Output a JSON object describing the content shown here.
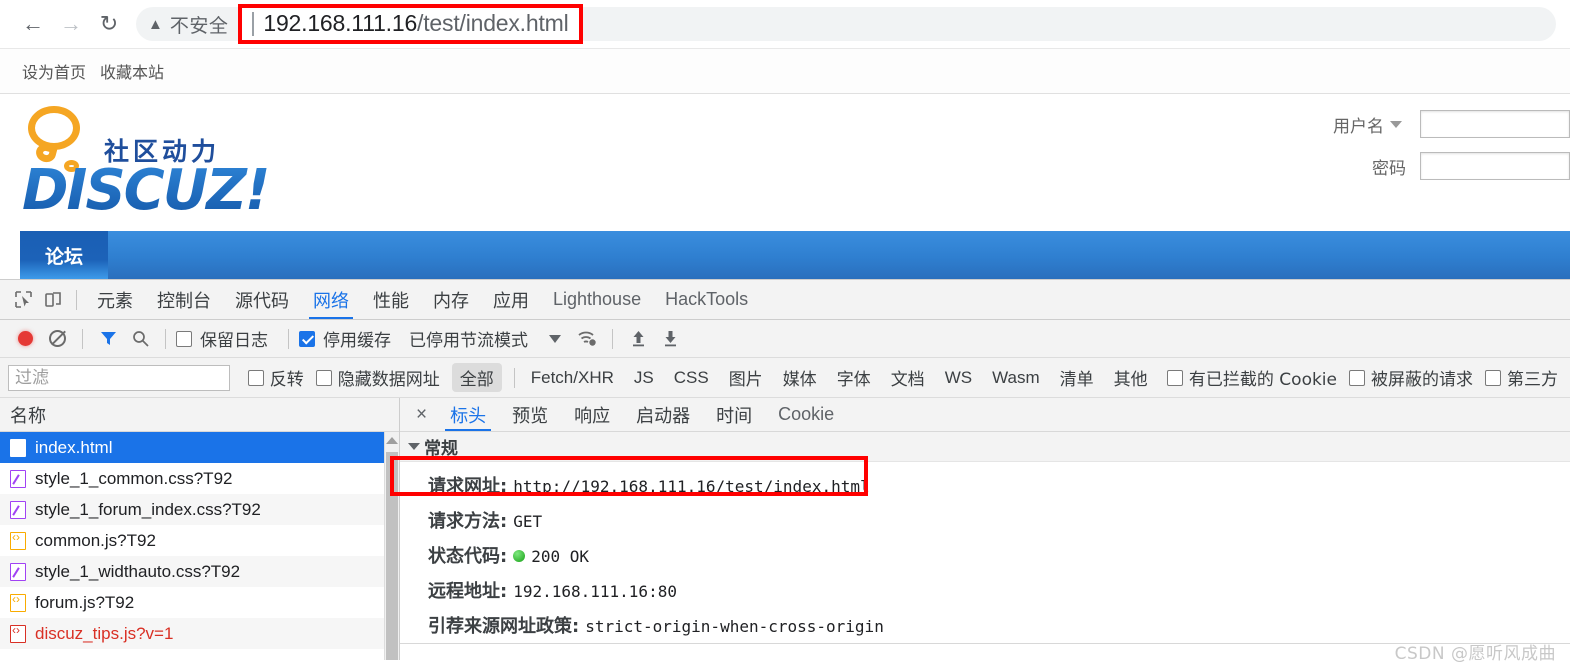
{
  "browser": {
    "back_icon": "arrow-left",
    "forward_icon": "arrow-right",
    "reload_icon": "reload",
    "security_label": "不安全",
    "url_host": "192.168.111.16",
    "url_path": "/test/index.html",
    "highlight_color": "#ff0000"
  },
  "page": {
    "quicknav": [
      "设为首页",
      "收藏本站"
    ],
    "logo": {
      "cn_tagline": "社区动力",
      "wordmark": "DISCUZ!"
    },
    "login": {
      "username_label": "用户名",
      "password_label": "密码",
      "username_value": "",
      "password_value": ""
    },
    "forum_nav": {
      "tab": "论坛"
    }
  },
  "devtools": {
    "tabs": [
      {
        "label": "元素",
        "active": false,
        "latin": false
      },
      {
        "label": "控制台",
        "active": false,
        "latin": false
      },
      {
        "label": "源代码",
        "active": false,
        "latin": false
      },
      {
        "label": "网络",
        "active": true,
        "latin": false
      },
      {
        "label": "性能",
        "active": false,
        "latin": false
      },
      {
        "label": "内存",
        "active": false,
        "latin": false
      },
      {
        "label": "应用",
        "active": false,
        "latin": false
      },
      {
        "label": "Lighthouse",
        "active": false,
        "latin": true
      },
      {
        "label": "HackTools",
        "active": false,
        "latin": true
      }
    ],
    "toolbar": {
      "record_icon": "record-dot",
      "clear_icon": "clear-circle",
      "filter_icon": "funnel-icon",
      "search_icon": "search-icon",
      "preserve_log_label": "保留日志",
      "preserve_log_checked": false,
      "disable_cache_label": "停用缓存",
      "disable_cache_checked": true,
      "throttle_label": "已停用节流模式",
      "wifi_icon": "wifi-gear-icon",
      "upload_icon": "upload-arrow",
      "download_icon": "download-arrow"
    },
    "filterbar": {
      "filter_placeholder": "过滤",
      "filter_value": "",
      "invert_label": "反转",
      "invert_checked": false,
      "hide_data_urls_label": "隐藏数据网址",
      "hide_data_urls_checked": false,
      "types": [
        {
          "label": "全部",
          "selected": true,
          "latin": false
        },
        {
          "label": "Fetch/XHR",
          "selected": false,
          "latin": true
        },
        {
          "label": "JS",
          "selected": false,
          "latin": true
        },
        {
          "label": "CSS",
          "selected": false,
          "latin": true
        },
        {
          "label": "图片",
          "selected": false,
          "latin": false
        },
        {
          "label": "媒体",
          "selected": false,
          "latin": false
        },
        {
          "label": "字体",
          "selected": false,
          "latin": false
        },
        {
          "label": "文档",
          "selected": false,
          "latin": false
        },
        {
          "label": "WS",
          "selected": false,
          "latin": true
        },
        {
          "label": "Wasm",
          "selected": false,
          "latin": true
        },
        {
          "label": "清单",
          "selected": false,
          "latin": false
        },
        {
          "label": "其他",
          "selected": false,
          "latin": false
        }
      ],
      "blocked_cookies_label": "有已拦截的 Cookie",
      "blocked_cookies_checked": false,
      "blocked_requests_label": "被屏蔽的请求",
      "blocked_requests_checked": false,
      "third_party_label": "第三方",
      "third_party_checked": false
    },
    "requests": {
      "column_header": "名称",
      "rows": [
        {
          "name": "index.html",
          "kind": "html",
          "selected": true,
          "error": false
        },
        {
          "name": "style_1_common.css?T92",
          "kind": "css",
          "selected": false,
          "error": false
        },
        {
          "name": "style_1_forum_index.css?T92",
          "kind": "css",
          "selected": false,
          "error": false
        },
        {
          "name": "common.js?T92",
          "kind": "js",
          "selected": false,
          "error": false
        },
        {
          "name": "style_1_widthauto.css?T92",
          "kind": "css",
          "selected": false,
          "error": false
        },
        {
          "name": "forum.js?T92",
          "kind": "js",
          "selected": false,
          "error": false
        },
        {
          "name": "discuz_tips.js?v=1",
          "kind": "jserr",
          "selected": false,
          "error": true
        }
      ]
    },
    "detail": {
      "close_icon": "×",
      "tabs": [
        {
          "label": "标头",
          "active": true,
          "latin": false
        },
        {
          "label": "预览",
          "active": false,
          "latin": false
        },
        {
          "label": "响应",
          "active": false,
          "latin": false
        },
        {
          "label": "启动器",
          "active": false,
          "latin": false
        },
        {
          "label": "时间",
          "active": false,
          "latin": false
        },
        {
          "label": "Cookie",
          "active": false,
          "latin": true
        }
      ],
      "section_title": "常规",
      "rows": [
        {
          "key": "请求网址:",
          "value": "http://192.168.111.16/test/index.html",
          "highlight": true
        },
        {
          "key": "请求方法:",
          "value": "GET",
          "highlight": false
        },
        {
          "key": "状态代码:",
          "value": "200 OK",
          "status_dot": true,
          "highlight": false
        },
        {
          "key": "远程地址:",
          "value": "192.168.111.16:80",
          "highlight": false
        },
        {
          "key": "引荐来源网址政策:",
          "value": "strict-origin-when-cross-origin",
          "highlight": false
        }
      ]
    }
  },
  "watermark": "CSDN @愿听风成曲"
}
